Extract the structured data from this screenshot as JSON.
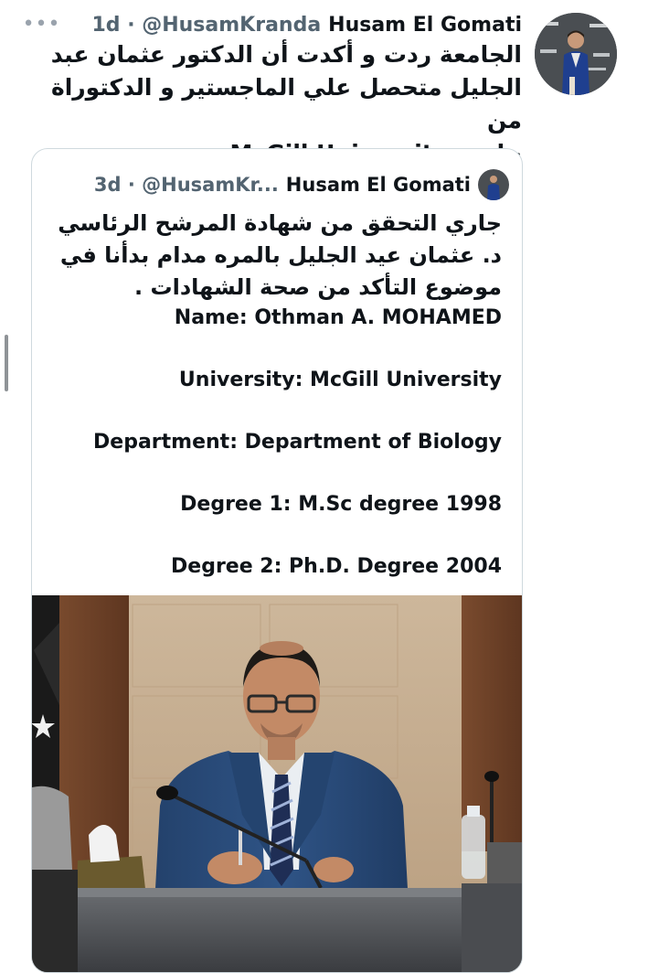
{
  "tweet": {
    "more_icon": "more-horizontal-icon",
    "meta": "1d · @HusamKranda",
    "author": "Husam El Gomati",
    "text_line1": "الجامعة ردت و أكدت أن الدكتور عثمان عبد",
    "text_line2": "الجليل متحصل علي الماجستير و الدكتوراة من",
    "text_line3_arabic": "جامعة",
    "text_line3_latin": "McGill University"
  },
  "quoted": {
    "meta": "3d · @HusamKr...",
    "author": "Husam El Gomati",
    "arabic_line1": "جاري التحقق من شهادة المرشح الرئاسي",
    "arabic_line2": "د. عثمان عيد الجليل بالمره مدام بدأنا في",
    "arabic_line3": "موضوع التأكد من صحة الشهادات .",
    "name": "Name: Othman A. MOHAMED",
    "university": "University: McGill University",
    "department": "Department: Department of Biology",
    "degree1": "Degree 1: M.Sc degree 1998",
    "degree2": "Degree 2: Ph.D. Degree 2004"
  },
  "colors": {
    "text": "#0f1419",
    "meta": "#536471",
    "border": "#cfd9de",
    "suit": "#2f4f7a"
  }
}
